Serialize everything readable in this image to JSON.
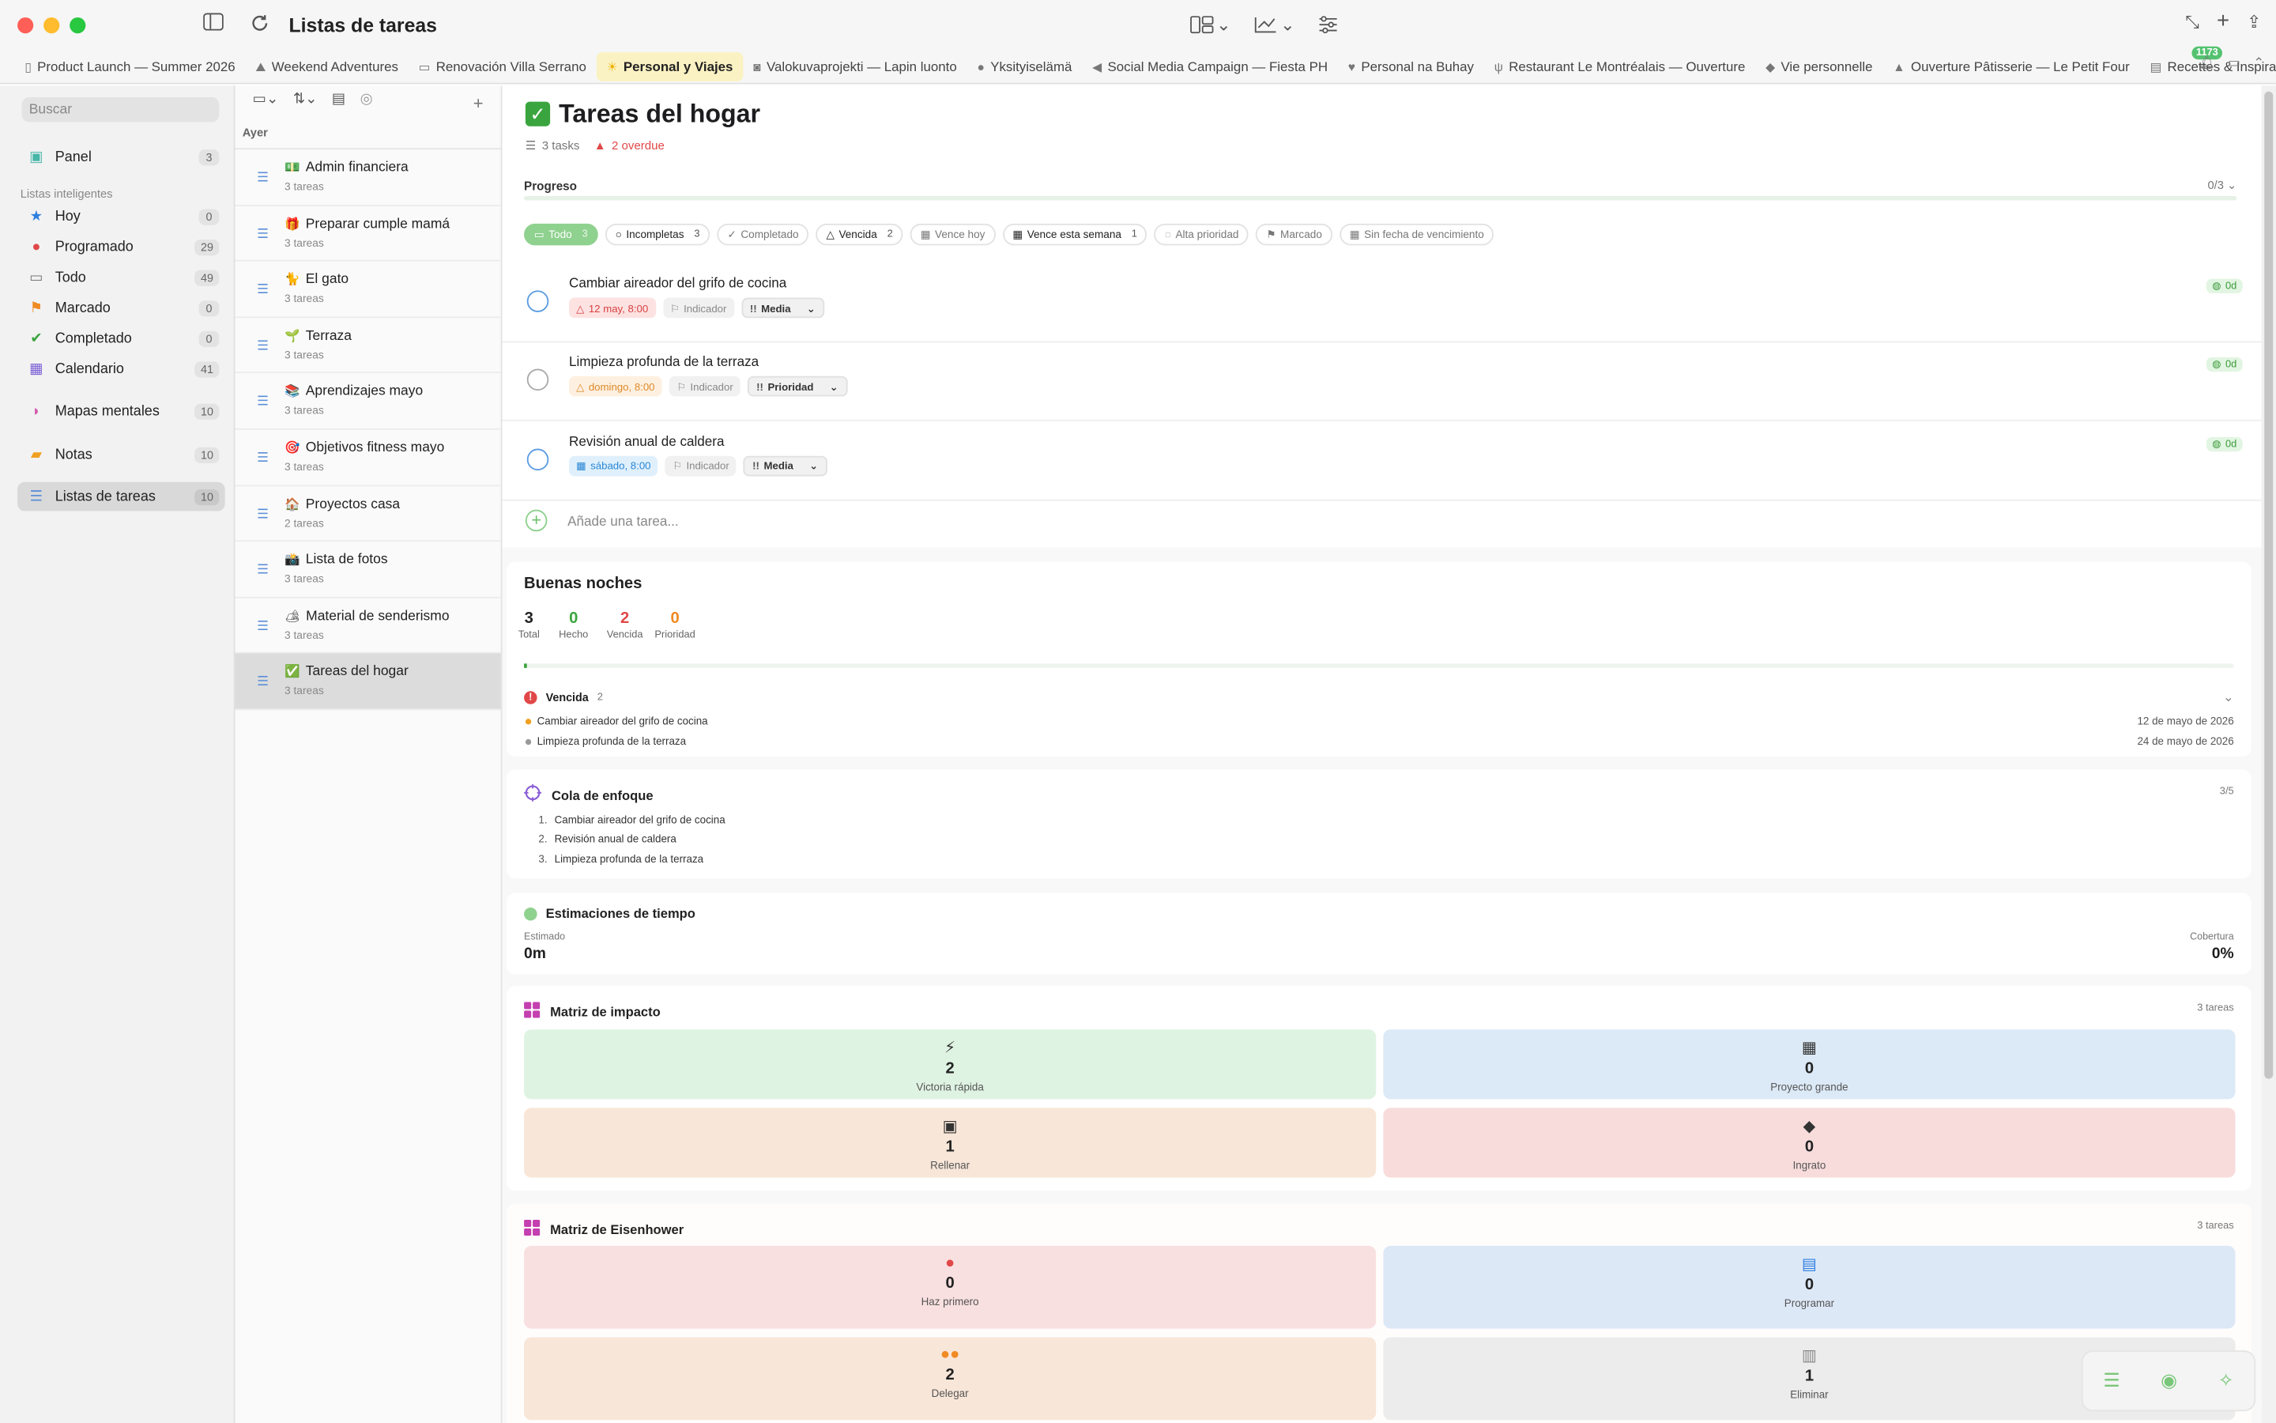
{
  "window": {
    "title": "Listas de tareas"
  },
  "tabs": [
    {
      "icon": "doc-icon",
      "label": "Product Launch — Summer 2026"
    },
    {
      "icon": "hiker-icon",
      "label": "Weekend Adventures"
    },
    {
      "icon": "car-icon",
      "label": "Renovación Villa Serrano"
    },
    {
      "icon": "sun-icon",
      "label": "Personal y Viajes",
      "active": true
    },
    {
      "icon": "camera-icon",
      "label": "Valokuvaprojekti — Lapin luonto"
    },
    {
      "icon": "dot-icon",
      "label": "Yksityiselämä"
    },
    {
      "icon": "megaphone-icon",
      "label": "Social Media Campaign — Fiesta PH"
    },
    {
      "icon": "heart-icon",
      "label": "Personal na Buhay"
    },
    {
      "icon": "fork-icon",
      "label": "Restaurant Le Montréalais — Ouverture"
    },
    {
      "icon": "tag-icon",
      "label": "Vie personnelle"
    },
    {
      "icon": "cake-icon",
      "label": "Ouverture Pâtisserie — Le Petit Four"
    },
    {
      "icon": "book-icon",
      "label": "Recettes & Inspirations"
    }
  ],
  "notifications_count": "1173",
  "sidebar": {
    "search_placeholder": "Buscar",
    "panel": {
      "label": "Panel",
      "count": "3"
    },
    "smart_lists_title": "Listas inteligentes",
    "smart_lists": [
      {
        "label": "Hoy",
        "count": "0",
        "icon": "star-icon",
        "color": "#2f7fe0"
      },
      {
        "label": "Programado",
        "count": "29",
        "icon": "calendar-clock-icon",
        "color": "#e04848"
      },
      {
        "label": "Todo",
        "count": "49",
        "icon": "tray-icon",
        "color": "#777777"
      },
      {
        "label": "Marcado",
        "count": "0",
        "icon": "flag-icon",
        "color": "#f08a24"
      },
      {
        "label": "Completado",
        "count": "0",
        "icon": "check-circle-icon",
        "color": "#3aa53e"
      },
      {
        "label": "Calendario",
        "count": "41",
        "icon": "calendar-icon",
        "color": "#7b5fd6"
      }
    ],
    "others": [
      {
        "label": "Mapas mentales",
        "count": "10",
        "icon": "brain-icon",
        "color": "#d45fb0"
      },
      {
        "label": "Notas",
        "count": "10",
        "icon": "note-icon",
        "color": "#f0a020"
      },
      {
        "label": "Listas de tareas",
        "count": "10",
        "icon": "checklist-icon",
        "color": "#5b8fd8",
        "active": true
      }
    ]
  },
  "list_pane": {
    "day_header": "Ayer",
    "items": [
      {
        "emoji": "💵",
        "title": "Admin financiera",
        "subtitle": "3 tareas"
      },
      {
        "emoji": "🎁",
        "title": "Preparar cumple mamá",
        "subtitle": "3 tareas"
      },
      {
        "emoji": "🐈",
        "title": "El gato",
        "subtitle": "3 tareas"
      },
      {
        "emoji": "🌱",
        "title": "Terraza",
        "subtitle": "3 tareas"
      },
      {
        "emoji": "📚",
        "title": "Aprendizajes mayo",
        "subtitle": "3 tareas"
      },
      {
        "emoji": "🎯",
        "title": "Objetivos fitness mayo",
        "subtitle": "3 tareas"
      },
      {
        "emoji": "🏠",
        "title": "Proyectos casa",
        "subtitle": "2 tareas"
      },
      {
        "emoji": "📸",
        "title": "Lista de fotos",
        "subtitle": "3 tareas"
      },
      {
        "emoji": "🏕",
        "title": "Material de senderismo",
        "subtitle": "3 tareas"
      },
      {
        "emoji": "✅",
        "title": "Tareas del hogar",
        "subtitle": "3 tareas",
        "active": true
      }
    ]
  },
  "main": {
    "title": "Tareas del hogar",
    "task_count": "3 tasks",
    "overdue": "2 overdue",
    "progress_label": "Progreso",
    "progress_value": "0/3",
    "filters": [
      {
        "label": "Todo",
        "count": "3",
        "on": true
      },
      {
        "label": "Incompletas",
        "count": "3",
        "dark": true
      },
      {
        "label": "Completado",
        "count": ""
      },
      {
        "label": "Vencida",
        "count": "2",
        "dark": true
      },
      {
        "label": "Vence hoy",
        "count": ""
      },
      {
        "label": "Vence esta semana",
        "count": "1",
        "dark": true
      },
      {
        "label": "Alta prioridad",
        "count": ""
      },
      {
        "label": "Marcado",
        "count": ""
      },
      {
        "label": "Sin fecha de vencimiento",
        "count": ""
      }
    ],
    "tasks": [
      {
        "title": "Cambiar aireador del grifo de cocina",
        "date": "12 may, 8:00",
        "date_style": "red",
        "indicator": "Indicador",
        "priority": "Media",
        "badge": "0d",
        "circle": "blue"
      },
      {
        "title": "Limpieza profunda de la terraza",
        "date": "domingo, 8:00",
        "date_style": "orange",
        "indicator": "Indicador",
        "priority": "Prioridad",
        "badge": "0d",
        "circle": "grey"
      },
      {
        "title": "Revisión anual de caldera",
        "date": "sábado, 8:00",
        "date_style": "blue",
        "indicator": "Indicador",
        "priority": "Media",
        "badge": "0d",
        "circle": "blue"
      }
    ],
    "add_task_placeholder": "Añade una tarea..."
  },
  "summary": {
    "greeting": "Buenas noches",
    "stats": [
      {
        "value": "3",
        "label": "Total",
        "color": "#222222"
      },
      {
        "value": "0",
        "label": "Hecho",
        "color": "#3aa53e"
      },
      {
        "value": "2",
        "label": "Vencida",
        "color": "#e04848"
      },
      {
        "value": "0",
        "label": "Prioridad",
        "color": "#f08a24"
      }
    ],
    "overdue_title": "Vencida",
    "overdue_count": "2",
    "overdue_items": [
      {
        "title": "Cambiar aireador del grifo de cocina",
        "date": "12 de mayo de 2026",
        "dot": "#f0a020"
      },
      {
        "title": "Limpieza profunda de la terraza",
        "date": "24 de mayo de 2026",
        "dot": "#999999"
      }
    ]
  },
  "focus": {
    "title": "Cola de enfoque",
    "count": "3/5",
    "items": [
      "Cambiar aireador del grifo de cocina",
      "Revisión anual de caldera",
      "Limpieza profunda de la terraza"
    ]
  },
  "estimates": {
    "title": "Estimaciones de tiempo",
    "estimated_label": "Estimado",
    "estimated_value": "0m",
    "coverage_label": "Cobertura",
    "coverage_value": "0%"
  },
  "impact": {
    "title": "Matriz de impacto",
    "count": "3 tareas",
    "cells": [
      {
        "icon": "bolt-icon",
        "glyph": "⚡",
        "value": "2",
        "label": "Victoria rápida",
        "bg": "#dff3e2"
      },
      {
        "icon": "building-icon",
        "glyph": "▦",
        "value": "0",
        "label": "Proyecto grande",
        "bg": "#dce9f7"
      },
      {
        "icon": "grid-icon",
        "glyph": "▣",
        "value": "1",
        "label": "Rellenar",
        "bg": "#f8e6d8"
      },
      {
        "icon": "turtle-icon",
        "glyph": "◆",
        "value": "0",
        "label": "Ingrato",
        "bg": "#f8dcdc"
      }
    ]
  },
  "eisenhower": {
    "title": "Matriz de Eisenhower",
    "count": "3 tareas",
    "cells": [
      {
        "icon": "fire-icon",
        "glyph": "●",
        "value": "0",
        "label": "Haz primero",
        "bg": "#f9e0e0",
        "color": "#e04848"
      },
      {
        "icon": "calendar-icon",
        "glyph": "▤",
        "value": "0",
        "label": "Programar",
        "bg": "#dde8f7",
        "color": "#2f7fe0"
      },
      {
        "icon": "people-icon",
        "glyph": "●●",
        "value": "2",
        "label": "Delegar",
        "bg": "#f8e6d8",
        "color": "#f08a24"
      },
      {
        "icon": "trash-icon",
        "glyph": "▥",
        "value": "1",
        "label": "Eliminar",
        "bg": "#ececec",
        "color": "#888888"
      }
    ]
  }
}
